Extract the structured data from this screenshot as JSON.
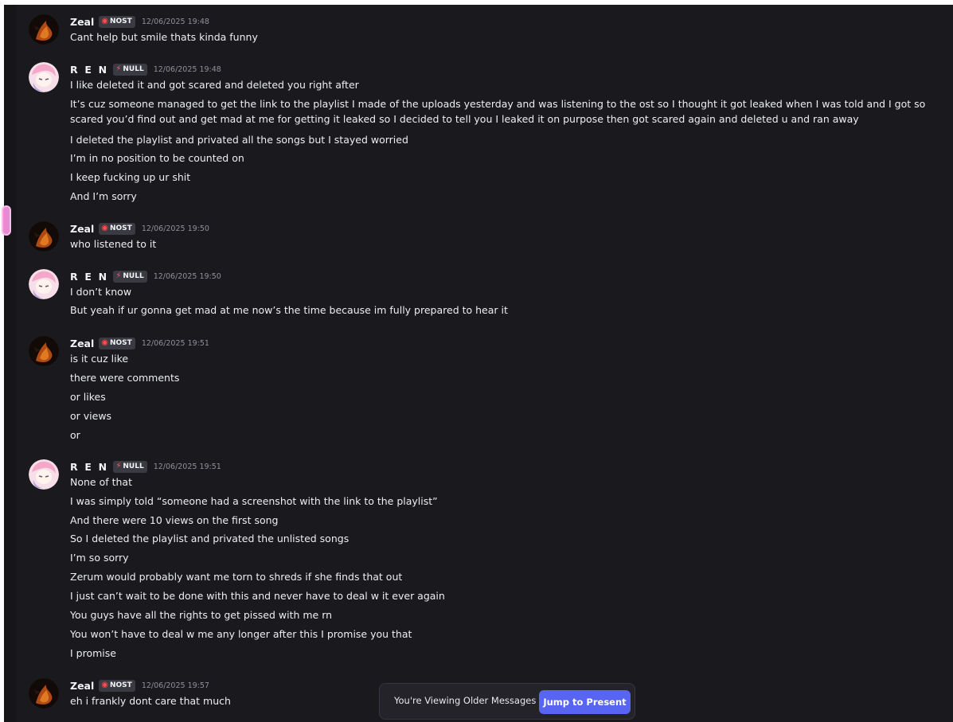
{
  "users": {
    "zeal": {
      "name": "Zeal",
      "tag": "NOST",
      "tag_icon": "flame-ring-icon"
    },
    "ren": {
      "name": "R E N",
      "tag": "NULL",
      "tag_icon": "lightning-icon"
    }
  },
  "groups": [
    {
      "user": "Zeal",
      "tag": "NOST",
      "timestamp": "12/06/2025 19:48",
      "lines": [
        "Cant help but smile thats kinda funny"
      ]
    },
    {
      "user": "R E N",
      "tag": "NULL",
      "timestamp": "12/06/2025 19:48",
      "lines": [
        "I like deleted it and got scared and deleted you right after",
        "It’s cuz someone managed to get the link to the playlist I made of the uploads yesterday and was listening to the ost so I thought it got leaked when I was told and I got so scared you’d find out and get mad at me for getting it leaked so I decided to tell you I leaked it on purpose then got scared again and deleted u and ran away",
        "I deleted the playlist and privated all the songs but I stayed worried",
        "I’m in no position to be counted on",
        "I keep fucking up ur shit",
        "And I’m sorry"
      ]
    },
    {
      "user": "Zeal",
      "tag": "NOST",
      "timestamp": "12/06/2025 19:50",
      "lines": [
        "who listened to it"
      ]
    },
    {
      "user": "R E N",
      "tag": "NULL",
      "timestamp": "12/06/2025 19:50",
      "lines": [
        "I don’t know",
        "But yeah if ur gonna get mad at me now’s the time because im fully prepared to hear it"
      ]
    },
    {
      "user": "Zeal",
      "tag": "NOST",
      "timestamp": "12/06/2025 19:51",
      "lines": [
        "is it cuz like",
        "there were comments",
        "or likes",
        "or views",
        "or"
      ]
    },
    {
      "user": "R E N",
      "tag": "NULL",
      "timestamp": "12/06/2025 19:51",
      "lines": [
        "None of that",
        "I was simply told “someone had a screenshot with the link to the playlist”",
        "And there were 10 views on the first song",
        "So I deleted the playlist and privated the unlisted songs",
        "I’m so sorry",
        "Zerum would probably want me torn to shreds if she finds that out",
        "I just can’t wait to be done with this and never have to deal w it ever again",
        "You guys have all the rights to get pissed with me rn",
        "You won’t have to deal w me any longer after this I promise you that",
        "I promise"
      ]
    },
    {
      "user": "Zeal",
      "tag": "NOST",
      "timestamp": "12/06/2025 19:57",
      "lines": [
        "eh i frankly dont care that much"
      ]
    }
  ],
  "jump_bar": {
    "text": "You're Viewing Older Messages",
    "button": "Jump to Present"
  },
  "colors": {
    "background": "#1a1a1e",
    "accent_button": "#5865f2",
    "nost_icon": "#ff4d4d",
    "null_icon": "#ff5a6e"
  }
}
